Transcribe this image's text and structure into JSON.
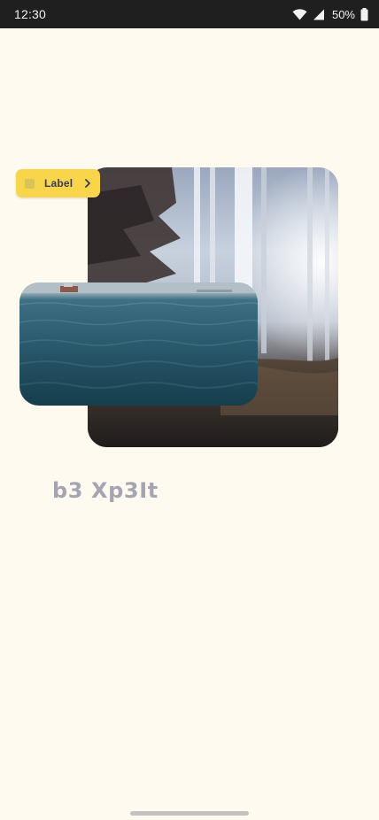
{
  "status_bar": {
    "time": "12:30",
    "battery": "50%",
    "icons": [
      "wifi-icon",
      "cellular-signal-icon",
      "battery-icon"
    ]
  },
  "chip": {
    "label": "Label",
    "icon": "chevron-right-icon",
    "color": "#f9d54c"
  },
  "images": {
    "forest": "forest-photo",
    "sea": "sea-photo"
  },
  "heading": "b3 Xp3It",
  "colors": {
    "background": "#fefaef",
    "heading": "#a6a4b3",
    "status_bar": "#1f1f1f"
  }
}
